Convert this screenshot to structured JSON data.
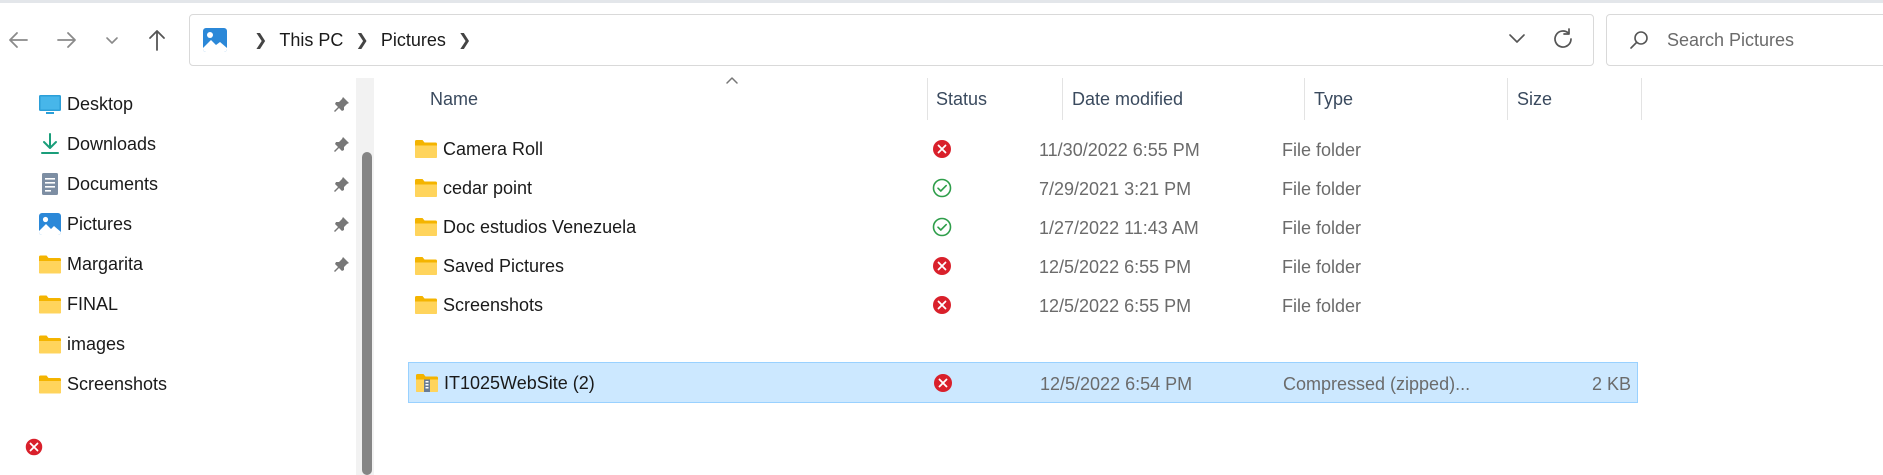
{
  "address": {
    "breadcrumbs": [
      "This PC",
      "Pictures"
    ]
  },
  "search": {
    "placeholder": "Search Pictures"
  },
  "sidebar": {
    "items": [
      {
        "label": "Desktop",
        "icon": "desktop-icon",
        "pinned": true
      },
      {
        "label": "Downloads",
        "icon": "downloads-icon",
        "pinned": true
      },
      {
        "label": "Documents",
        "icon": "documents-icon",
        "pinned": true
      },
      {
        "label": "Pictures",
        "icon": "pictures-icon",
        "pinned": true
      },
      {
        "label": "Margarita",
        "icon": "folder-icon",
        "pinned": true
      },
      {
        "label": "FINAL",
        "icon": "folder-icon",
        "pinned": false
      },
      {
        "label": "images",
        "icon": "folder-icon",
        "pinned": false
      },
      {
        "label": "Screenshots",
        "icon": "folder-icon",
        "pinned": false,
        "status": "sync-error"
      }
    ]
  },
  "columns": {
    "name": "Name",
    "status": "Status",
    "date": "Date modified",
    "type": "Type",
    "size": "Size"
  },
  "files": [
    {
      "name": "Camera Roll",
      "status": "sync-error",
      "date": "11/30/2022 6:55 PM",
      "type": "File folder",
      "size": "",
      "icon": "folder-icon"
    },
    {
      "name": "cedar point",
      "status": "synced",
      "date": "7/29/2021 3:21 PM",
      "type": "File folder",
      "size": "",
      "icon": "folder-icon"
    },
    {
      "name": "Doc estudios Venezuela",
      "status": "synced",
      "date": "1/27/2022 11:43 AM",
      "type": "File folder",
      "size": "",
      "icon": "folder-icon"
    },
    {
      "name": "Saved Pictures",
      "status": "sync-error",
      "date": "12/5/2022 6:55 PM",
      "type": "File folder",
      "size": "",
      "icon": "folder-icon"
    },
    {
      "name": "Screenshots",
      "status": "sync-error",
      "date": "12/5/2022 6:55 PM",
      "type": "File folder",
      "size": "",
      "icon": "folder-icon"
    },
    {
      "name": "IT1025WebSite (2)",
      "status": "sync-error",
      "date": "12/5/2022 6:54 PM",
      "type": "Compressed (zipped)...",
      "size": "2 KB",
      "icon": "zip-folder-icon",
      "selected": true
    }
  ],
  "colors": {
    "selection_bg": "#cce8ff",
    "selection_border": "#99d1ff",
    "folder": "#f7c948",
    "error": "#d9202b",
    "synced": "#2e9e4a"
  }
}
